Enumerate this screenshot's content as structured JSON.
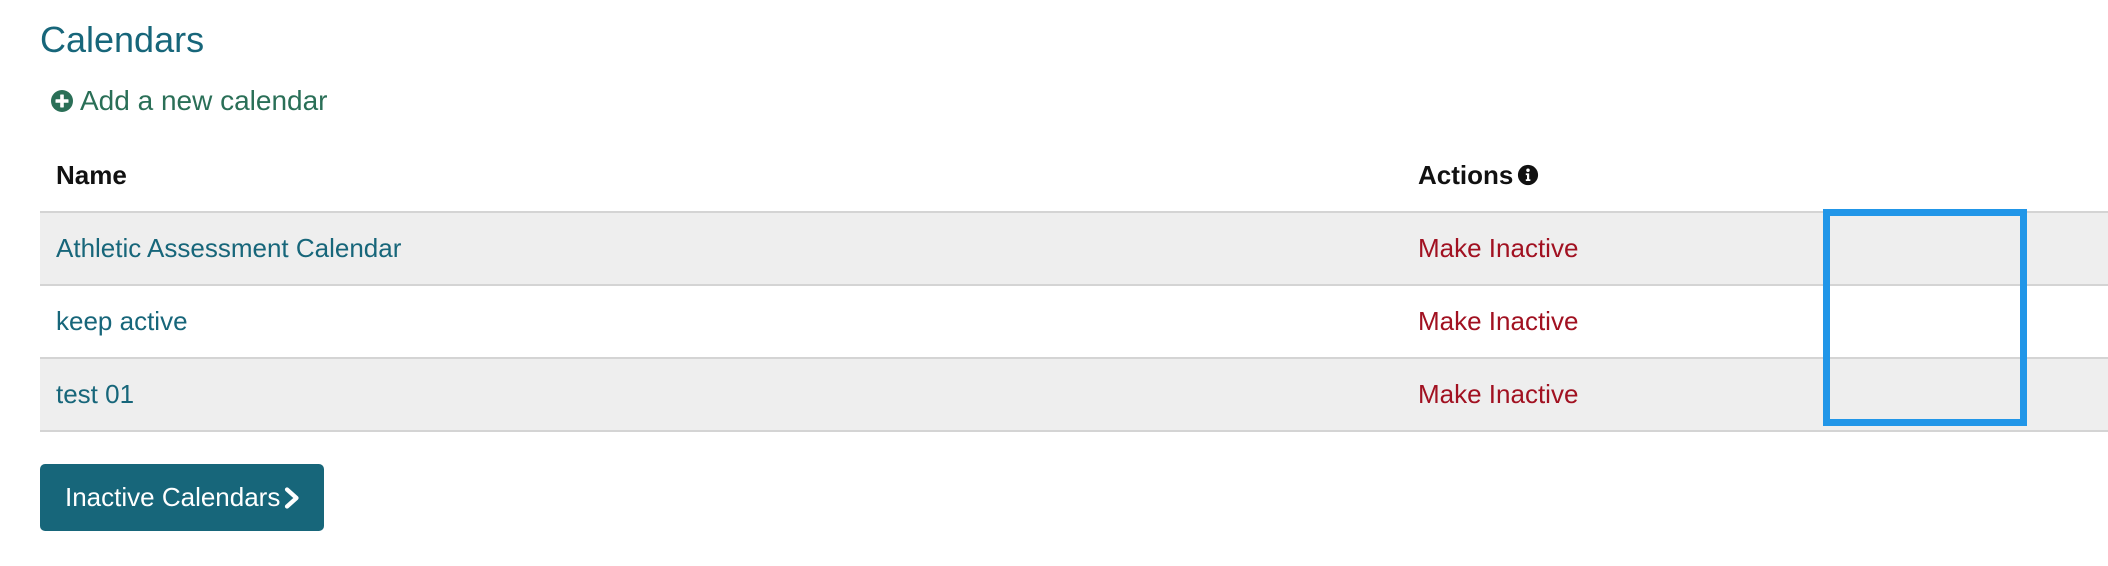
{
  "page": {
    "title": "Calendars"
  },
  "add_calendar": {
    "label": "Add a new calendar",
    "icon": "plus-circle-icon"
  },
  "table": {
    "columns": {
      "name": "Name",
      "actions": "Actions",
      "actions_icon": "info-icon"
    },
    "rows": [
      {
        "name": "Athletic Assessment Calendar",
        "action": "Make Inactive"
      },
      {
        "name": "keep active",
        "action": "Make Inactive"
      },
      {
        "name": "test 01",
        "action": "Make Inactive"
      }
    ]
  },
  "inactive_button": {
    "label": "Inactive Calendars",
    "icon": "chevron-right-icon"
  },
  "colors": {
    "title": "#17667a",
    "add_link": "#2a6f57",
    "name_link": "#17667a",
    "action_link": "#a11121",
    "button_bg": "#17667a",
    "highlight": "#2196e8",
    "row_stripe": "#eeeeee"
  }
}
